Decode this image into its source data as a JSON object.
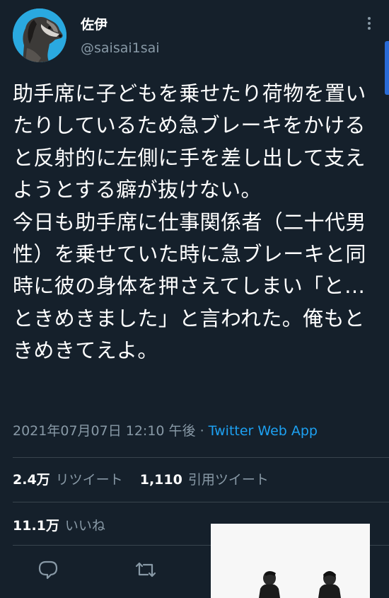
{
  "tweet": {
    "display_name": "佐伊",
    "handle": "@saisai1sai",
    "text": "助手席に子どもを乗せたり荷物を置いたりしているため急ブレーキをかけると反射的に左側に手を差し出して支えようとする癖が抜けない。\n今日も助手席に仕事関係者（二十代男性）を乗せていた時に急ブレーキと同時に彼の身体を押さえてしまい「と…ときめきました」と言われた。俺もときめきてえよ。",
    "timestamp": "2021年07月07日 12:10 午後",
    "separator": " · ",
    "client": "Twitter Web App"
  },
  "stats": {
    "retweets_count": "2.4万",
    "retweets_label": "リツイート",
    "quotes_count": "1,110",
    "quotes_label": "引用ツイート",
    "likes_count": "11.1万",
    "likes_label": "いいね"
  },
  "icons": {
    "more": "more-vertical-icon",
    "reply": "reply-icon",
    "retweet": "retweet-icon"
  },
  "colors": {
    "background": "#15202b",
    "text": "#ffffff",
    "secondary": "#8899a6",
    "link": "#1da1f2",
    "divider": "#38444d",
    "avatar_bg": "#2aa9e0"
  }
}
